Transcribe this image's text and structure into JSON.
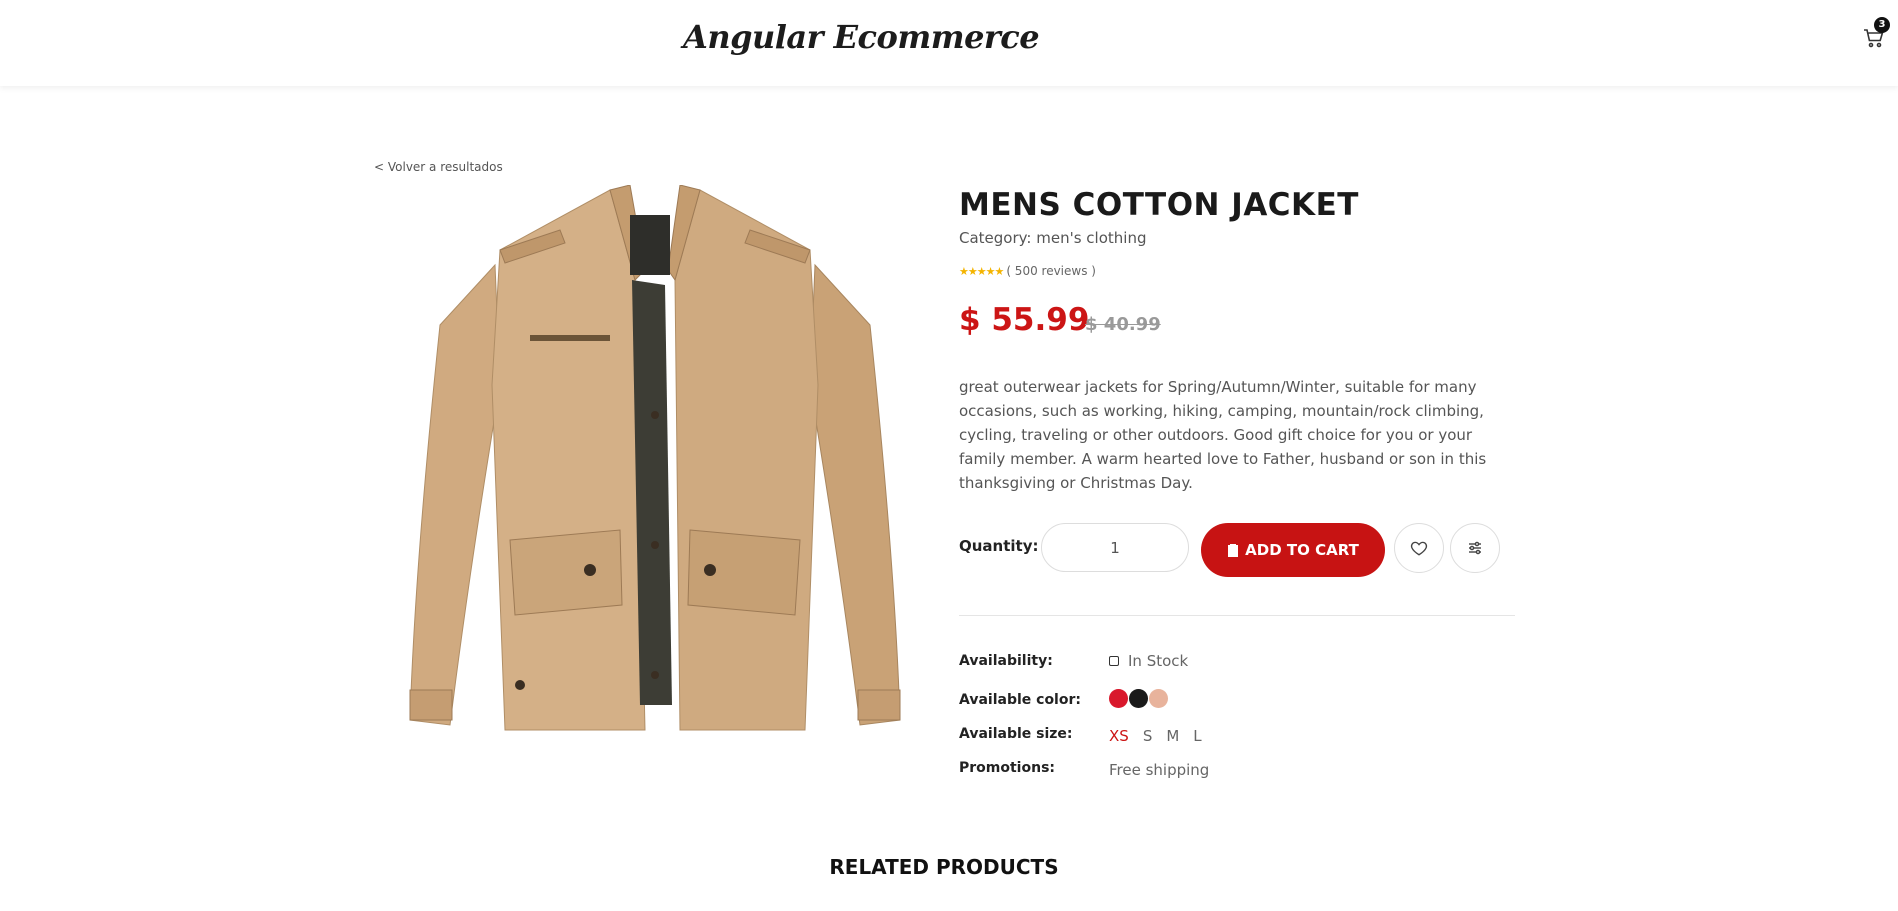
{
  "header": {
    "logo": "Angular Ecommerce",
    "cart_count": "3"
  },
  "nav": {
    "back_link": "< Volver a resultados"
  },
  "product": {
    "title": "MENS COTTON JACKET",
    "category_label": "Category: men's clothing",
    "rating_stars": 5,
    "reviews": "( 500 reviews )",
    "price": "$ 55.99",
    "old_price": "$ 40.99",
    "description": "great outerwear jackets for Spring/Autumn/Winter, suitable for many occasions, such as working, hiking, camping, mountain/rock climbing, cycling, traveling or other outdoors. Good gift choice for you or your family member. A warm hearted love to Father, husband or son in this thanksgiving or Christmas Day."
  },
  "purchase": {
    "quantity_label": "Quantity:",
    "quantity_value": "1",
    "add_to_cart_label": "ADD TO CART"
  },
  "meta": {
    "availability_label": "Availability:",
    "availability_value": "In Stock",
    "color_label": "Available color:",
    "colors": [
      "#d9182c",
      "#1a1a1a",
      "#e8b39c"
    ],
    "size_label": "Available size:",
    "sizes": [
      "XS",
      "S",
      "M",
      "L"
    ],
    "selected_size": "XS",
    "promotions_label": "Promotions:",
    "promotions_value": "Free shipping"
  },
  "related": {
    "heading": "RELATED PRODUCTS"
  },
  "colors": {
    "accent": "#c71313",
    "star": "#f4b400"
  }
}
